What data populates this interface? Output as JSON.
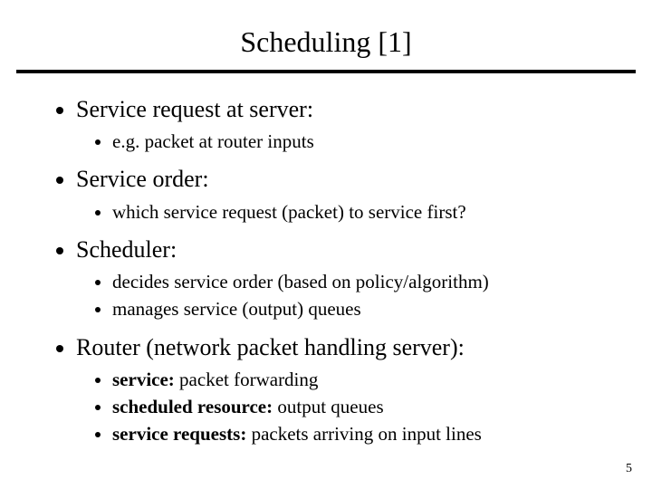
{
  "title": "Scheduling [1]",
  "bullets": {
    "b1": "Service request at server:",
    "b1s1": "e.g. packet at router inputs",
    "b2": "Service order:",
    "b2s1": "which service request (packet) to service first?",
    "b3": "Scheduler:",
    "b3s1": "decides service order (based on policy/algorithm)",
    "b3s2": "manages service (output) queues",
    "b4": "Router (network packet handling server):",
    "b4s1_bold": "service:",
    "b4s1_rest": " packet forwarding",
    "b4s2_bold": "scheduled resource:",
    "b4s2_rest": " output queues",
    "b4s3_bold": "service requests:",
    "b4s3_rest": " packets arriving on input lines"
  },
  "page_number": "5"
}
